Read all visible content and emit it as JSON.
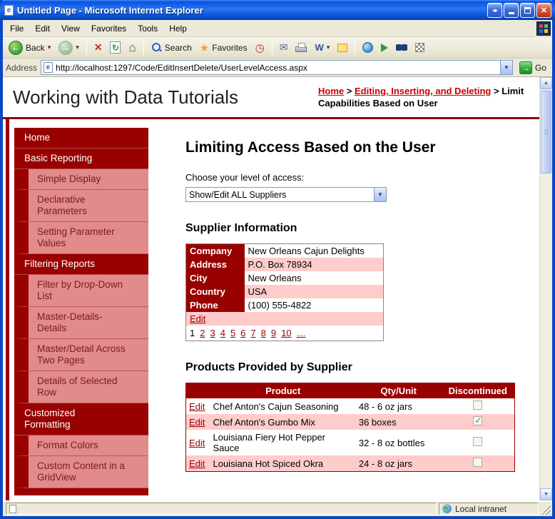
{
  "window": {
    "title": "Untitled Page - Microsoft Internet Explorer"
  },
  "menu_bar": {
    "items": [
      "File",
      "Edit",
      "View",
      "Favorites",
      "Tools",
      "Help"
    ]
  },
  "toolbar": {
    "back_label": "Back",
    "search_label": "Search",
    "favorites_label": "Favorites",
    "edit_icon_label": "W"
  },
  "address_bar": {
    "label": "Address",
    "url": "http://localhost:1297/Code/EditInsertDelete/UserLevelAccess.aspx",
    "go_label": "Go"
  },
  "masthead": {
    "title": "Working with Data Tutorials",
    "breadcrumb": {
      "home": "Home",
      "separator": ">",
      "section": "Editing, Inserting, and Deleting",
      "current": "Limit Capabilities Based on User"
    }
  },
  "sidebar": {
    "items": [
      {
        "label": "Home"
      },
      {
        "label": "Basic Reporting"
      },
      {
        "label": "Simple Display"
      },
      {
        "label": "Declarative Parameters"
      },
      {
        "label": "Setting Parameter Values"
      },
      {
        "label": "Filtering Reports"
      },
      {
        "label": "Filter by Drop-Down List"
      },
      {
        "label": "Master-Details-Details"
      },
      {
        "label": "Master/Detail Across Two Pages"
      },
      {
        "label": "Details of Selected Row"
      },
      {
        "label": "Customized Formatting"
      },
      {
        "label": "Format Colors"
      },
      {
        "label": "Custom Content in a GridView"
      }
    ]
  },
  "main": {
    "page_heading": "Limiting Access Based on the User",
    "access_label": "Choose your level of access:",
    "access_selected": "Show/Edit ALL Suppliers",
    "supplier_section": {
      "heading": "Supplier Information",
      "fields": [
        {
          "name": "Company",
          "value": "New Orleans Cajun Delights"
        },
        {
          "name": "Address",
          "value": "P.O. Box 78934"
        },
        {
          "name": "City",
          "value": "New Orleans"
        },
        {
          "name": "Country",
          "value": "USA"
        },
        {
          "name": "Phone",
          "value": "(100) 555-4822"
        }
      ],
      "edit_label": "Edit",
      "pager": {
        "current": "1",
        "pages": [
          "2",
          "3",
          "4",
          "5",
          "6",
          "7",
          "8",
          "9",
          "10",
          "…"
        ]
      }
    },
    "products_section": {
      "heading": "Products Provided by Supplier",
      "columns": {
        "product": "Product",
        "qty": "Qty/Unit",
        "discontinued": "Discontinued"
      },
      "edit_label": "Edit",
      "rows": [
        {
          "product": "Chef Anton's Cajun Seasoning",
          "qty": "48 - 6 oz jars",
          "discontinued": false
        },
        {
          "product": "Chef Anton's Gumbo Mix",
          "qty": "36 boxes",
          "discontinued": true
        },
        {
          "product": "Louisiana Fiery Hot Pepper Sauce",
          "qty": "32 - 8 oz bottles",
          "discontinued": false
        },
        {
          "product": "Louisiana Hot Spiced Okra",
          "qty": "24 - 8 oz jars",
          "discontinued": false
        }
      ]
    }
  },
  "status_bar": {
    "zone": "Local intranet"
  },
  "icons": {
    "window_resize": "◂▸",
    "close": "✕",
    "back_arrow": "←",
    "forward_arrow": "→",
    "chevron": "▾",
    "stop": "✕",
    "refresh": "↻",
    "home": "⌂",
    "star": "★",
    "history": "◷",
    "mail": "✉",
    "select_arrow": "▼",
    "address_arrow": "▼",
    "go_arrow": "→"
  },
  "colors": {
    "maroon": "#990000",
    "salmon": "#E18B8B",
    "row_pink": "#FFCCCC",
    "xp_title_blue": "#0D55E0",
    "link_red": "#CC0000"
  }
}
